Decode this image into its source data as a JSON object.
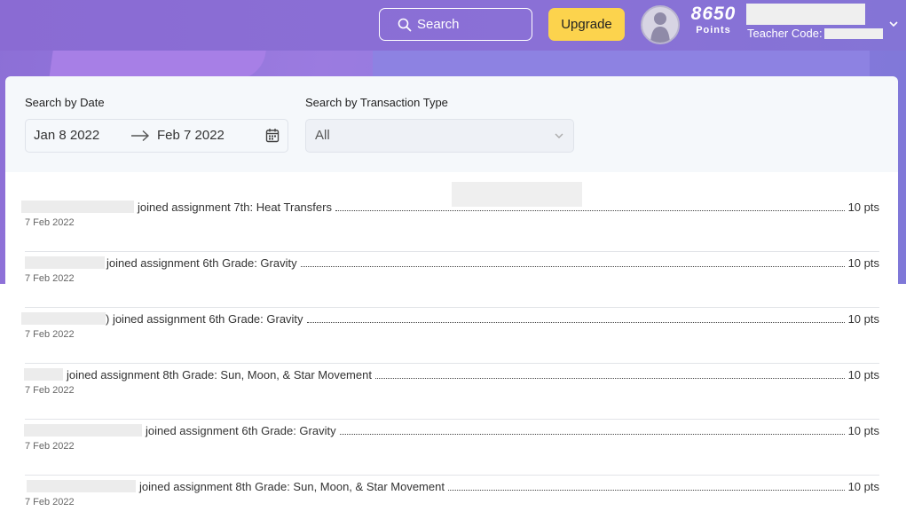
{
  "header": {
    "search_label": "Search",
    "upgrade_label": "Upgrade",
    "points_value": "8650",
    "points_label": "Points",
    "teacher_code_label": "Teacher Code:"
  },
  "filters": {
    "date_label": "Search by Date",
    "date_start": "Jan 8 2022",
    "date_end": "Feb 7 2022",
    "type_label": "Search by Transaction Type",
    "type_value": "All"
  },
  "transactions": [
    {
      "description": "joined assignment 7th: Heat Transfers",
      "points": "10 pts",
      "date": "7 Feb 2022"
    },
    {
      "description": "joined assignment 6th Grade: Gravity",
      "points": "10 pts",
      "date": "7 Feb 2022"
    },
    {
      "description": ") joined assignment 6th Grade: Gravity",
      "points": "10 pts",
      "date": "7 Feb 2022"
    },
    {
      "description": "joined assignment 8th Grade: Sun, Moon, & Star Movement",
      "points": "10 pts",
      "date": "7 Feb 2022"
    },
    {
      "description": "joined assignment 6th Grade: Gravity",
      "points": "10 pts",
      "date": "7 Feb 2022"
    },
    {
      "description": "joined assignment 8th Grade: Sun, Moon, & Star Movement",
      "points": "10 pts",
      "date": "7 Feb 2022"
    }
  ],
  "colors": {
    "header_purple": "#8a6bd3",
    "upgrade_yellow": "#fcd34d",
    "panel_bg": "#f5f8fb"
  },
  "icons": [
    "search-icon",
    "calendar-icon",
    "arrow-right-icon",
    "chevron-down-icon",
    "user-avatar"
  ]
}
